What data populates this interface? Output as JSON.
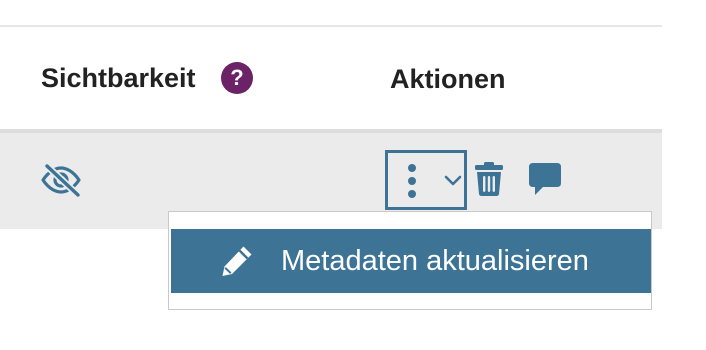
{
  "table": {
    "columns": {
      "visibility": "Sichtbarkeit",
      "visibility_help": "?",
      "actions": "Aktionen"
    },
    "row": {
      "visibility_icon": "eye-slash-icon",
      "action_icons": [
        "more-vertical-icon",
        "chevron-down-icon",
        "trash-icon",
        "comment-icon"
      ]
    }
  },
  "actions_menu": {
    "items": [
      {
        "icon": "pencil-icon",
        "label": "Metadaten aktualisieren"
      }
    ]
  },
  "colors": {
    "accent": "#3d7496",
    "help_badge": "#6b2266",
    "row_background": "#ebebeb",
    "header_text": "#222222"
  }
}
